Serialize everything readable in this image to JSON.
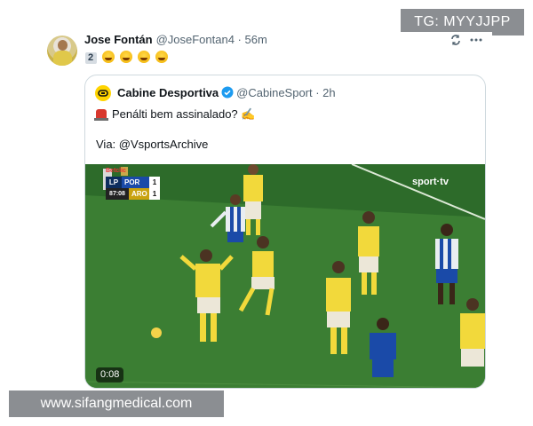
{
  "watermark_top": "TG: MYYJJPP",
  "watermark_bottom": "www.sifangmedical.com",
  "post": {
    "author_name": "Jose Fontán",
    "author_handle": "@JoseFontan4 · 56m",
    "number_emoji": "2",
    "laugh_emoji_count": 4,
    "icons": [
      "avatar",
      "repost-icon",
      "more-icon"
    ]
  },
  "quoted_post": {
    "author_name": "Cabine Desportiva",
    "author_handle": "@CabineSport · 2h",
    "text_line1": "Penálti bem assinalado? ✍️",
    "text_line2": "Via: @VsportsArchive",
    "icons": [
      "brand-logo-icon",
      "verified-badge-icon",
      "siren-icon"
    ],
    "video": {
      "duration": "0:08",
      "broadcaster_logo": "sport·tv",
      "scoreboard": {
        "league": "LP",
        "sponsor": "Betclic",
        "time": "87:08",
        "team_home": "POR",
        "score_home": "1",
        "team_away": "ARO",
        "score_away": "1"
      },
      "colors": {
        "pitch": "#3e8336",
        "home_kit": "#1a4aa8",
        "away_kit": "#f2d93b"
      }
    }
  }
}
